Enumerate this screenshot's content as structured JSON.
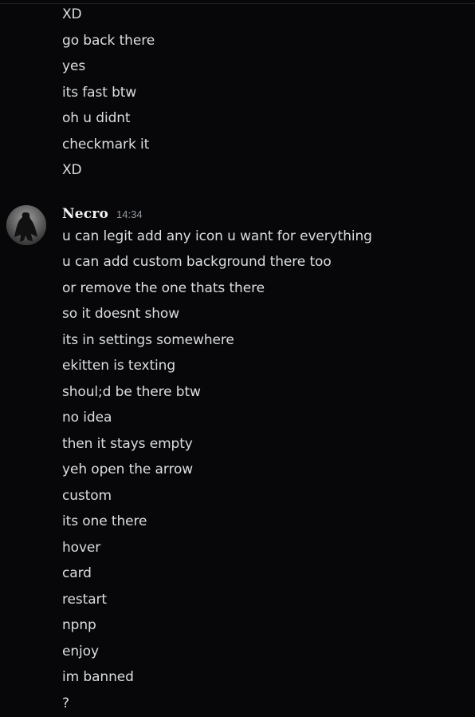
{
  "earlier_messages": [
    "XD",
    "go back there",
    "yes",
    "its fast btw",
    "oh u didnt",
    "checkmark it",
    "XD"
  ],
  "group": {
    "username": "Necro",
    "timestamp": "14:34",
    "messages": [
      "u can legit add any icon u want for everything",
      "u can add custom background there too",
      "or remove the one thats there",
      "so it doesnt show",
      "its in settings somewhere",
      "ekitten is texting",
      "shoul;d be there btw",
      "no idea",
      "then it stays empty",
      "yeh open the arrow",
      "custom",
      "its one there",
      "hover",
      "card",
      "restart",
      "npnp",
      "enjoy",
      "im banned",
      "?"
    ]
  }
}
